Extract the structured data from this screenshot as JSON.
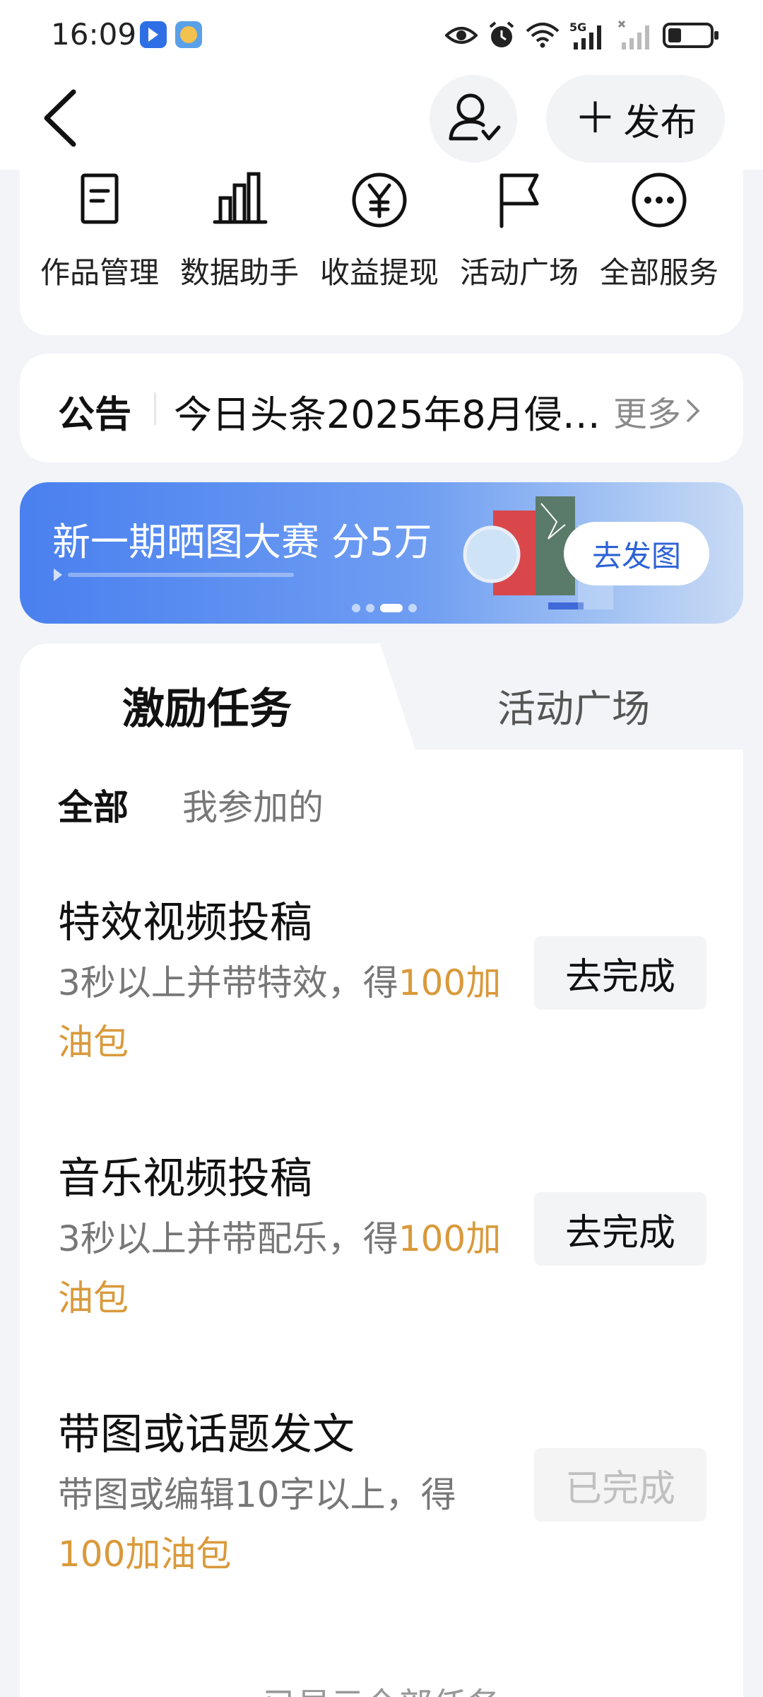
{
  "status_bar": {
    "time": "16:09",
    "icons": [
      "eye-icon",
      "alarm-icon",
      "wifi-icon",
      "signal-5g-icon",
      "signal-icon",
      "battery-icon"
    ],
    "network_label": "5G"
  },
  "header": {
    "publish_label": "发布"
  },
  "services": [
    {
      "label": "作品管理",
      "icon": "document-icon"
    },
    {
      "label": "数据助手",
      "icon": "bar-chart-icon"
    },
    {
      "label": "收益提现",
      "icon": "yen-icon"
    },
    {
      "label": "活动广场",
      "icon": "flag-icon"
    },
    {
      "label": "全部服务",
      "icon": "more-icon"
    }
  ],
  "notice": {
    "title": "公告",
    "text": "今日头条2025年8月侵…",
    "more": "更多"
  },
  "banner": {
    "title": "新一期晒图大赛 分5万",
    "button": "去发图",
    "slide_count": 4,
    "active_slide": 3
  },
  "tasks_section": {
    "tabs": [
      "激励任务",
      "活动广场"
    ],
    "active_tab": "激励任务",
    "filters": [
      "全部",
      "我参加的"
    ],
    "active_filter": "全部",
    "tasks": [
      {
        "title": "特效视频投稿",
        "desc": "3秒以上并带特效，得",
        "reward": "100加油包",
        "button": "去完成",
        "done": false
      },
      {
        "title": "音乐视频投稿",
        "desc": "3秒以上并带配乐，得",
        "reward": "100加油包",
        "button": "去完成",
        "done": false
      },
      {
        "title": "带图或话题发文",
        "desc": "带图或编辑10字以上，得",
        "reward": "100加油包",
        "button": "已完成",
        "done": true
      }
    ],
    "footer_hint": "已显示全部任务"
  },
  "colors": {
    "accent_orange": "#d99a3b",
    "banner_blue": "#4a80ef",
    "background": "#f2f4f8"
  }
}
